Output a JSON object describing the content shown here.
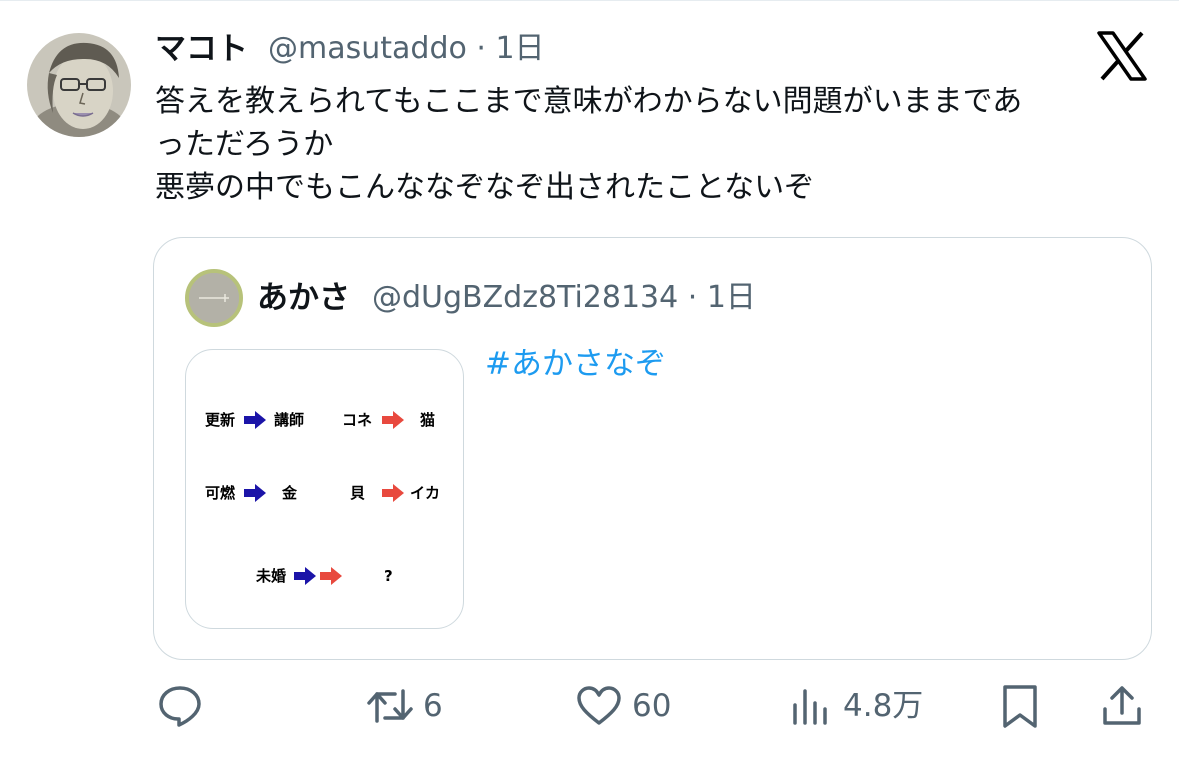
{
  "tweet": {
    "author_name": "マコト",
    "author_handle_time": "@masutaddo · 1日",
    "text_lines": [
      "答えを教えられてもここまで意味がわからない問題がいままであ",
      "っただろうか",
      "悪夢の中でもこんななぞなぞ出されたことないぞ"
    ]
  },
  "quote": {
    "author_name": "あかさ",
    "author_handle_time": "@dUgBZdz8Ti28134 · 1日",
    "hashtag": "#あかさなぞ",
    "image": {
      "row1_a": "更新",
      "row1_b": "講師",
      "row1_c": "コネ",
      "row1_d": "猫",
      "row2_a": "可燃",
      "row2_b": "金",
      "row2_c": "貝",
      "row2_d": "イカ",
      "row3_a": "未婚",
      "row3_b": "?",
      "arrow_blue": "#1b14a8",
      "arrow_red": "#e8493e"
    }
  },
  "actions": {
    "reply_icon": "reply-icon",
    "retweet_count": "6",
    "like_count": "60",
    "views_count": "4.8万",
    "bookmark_icon": "bookmark-icon",
    "share_icon": "share-icon"
  },
  "colors": {
    "text": "#0f1419",
    "secondary": "#536471",
    "link": "#1d9bf0",
    "border": "#cfd9de"
  }
}
